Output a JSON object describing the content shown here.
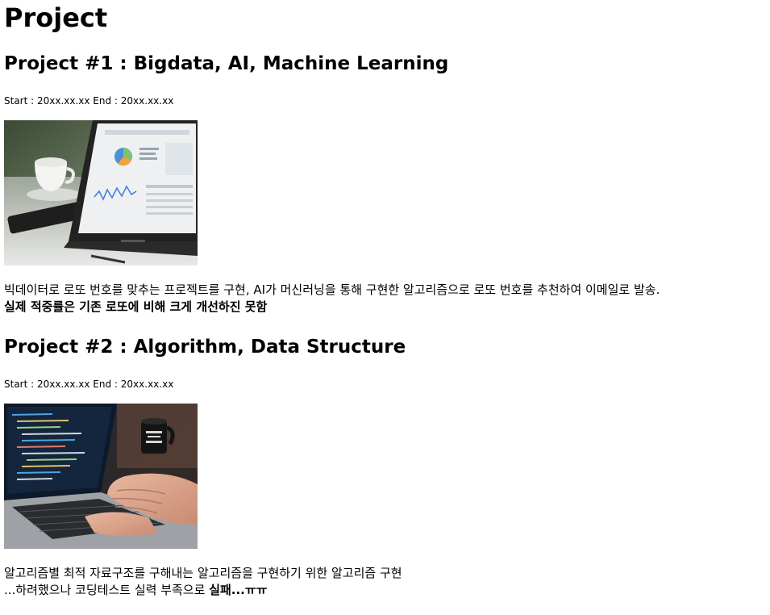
{
  "page": {
    "title": "Project"
  },
  "projects": [
    {
      "heading": "Project #1 : Bigdata, AI, Machine Learning",
      "dates": "Start : 20xx.xx.xx End : 20xx.xx.xx",
      "image_subject": "laptop-analytics-dashboard-photo",
      "description_line1": "빅데이터로 로또 번호를 맞추는 프로젝트를 구현, AI가 머신러닝을 통해 구현한 알고리즘으로 로또 번호를 추천하여 이메일로 발송.",
      "description_line2": "실제 적중률은 기존 로또에 비해 크게 개선하진 못함"
    },
    {
      "heading": "Project #2 : Algorithm, Data Structure",
      "dates": "Start : 20xx.xx.xx End : 20xx.xx.xx",
      "image_subject": "hands-typing-laptop-code-photo",
      "description_line1": "알고리즘별 최적 자료구조를 구해내는 알고리즘을 구현하기 위한 알고리즘 구현",
      "description_line2_prefix": "...하려했으나 코딩테스트 실력 부족으로 ",
      "description_line2_bold": "실패...ㅠㅠ"
    }
  ]
}
